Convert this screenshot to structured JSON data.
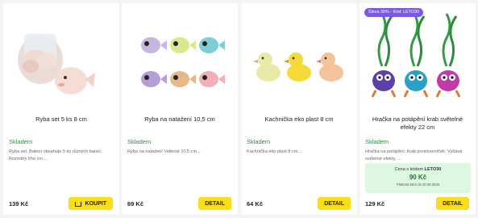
{
  "products": [
    {
      "title": "Ryba set 5 ks 8 cm",
      "stock": "Skladem",
      "desc": "Ryba set. Balení obsahuje 5 ks různých barev. Rozměry lího cm ...",
      "price": "139 Kč",
      "button": "KOUPIT"
    },
    {
      "title": "Ryba na natažení 10,5 cm",
      "stock": "Skladem",
      "desc": "Ryba na natažení Velikost 10,5 cm...",
      "price": "69 Kč",
      "button": "DETAIL"
    },
    {
      "title": "Kachnička eko plast 8 cm",
      "stock": "Skladem",
      "desc": "Kachnička eko plast 8 cm...",
      "price": "64 Kč",
      "button": "DETAIL"
    },
    {
      "badge": "Sleva 30% - Kód: LETO30",
      "title": "Hračka na potápění krab světelné efekty 22 cm",
      "stock": "Skladem",
      "desc": "Hračka na potápění, krab prostsveníček. Vyšává světelné efekty, ...",
      "promo_prefix": "Cena s kódem",
      "promo_code": "LETO30",
      "promo_price": "90 Kč",
      "promo_valid": "Platnost akce do 20.08.2026",
      "price": "129 Kč",
      "button": "DETAIL"
    }
  ],
  "colors": {
    "accent": "#f7dd1c",
    "stock": "#2e8b3e",
    "badge": "#7a5ae0",
    "promo_bg": "#ddf7e0"
  }
}
